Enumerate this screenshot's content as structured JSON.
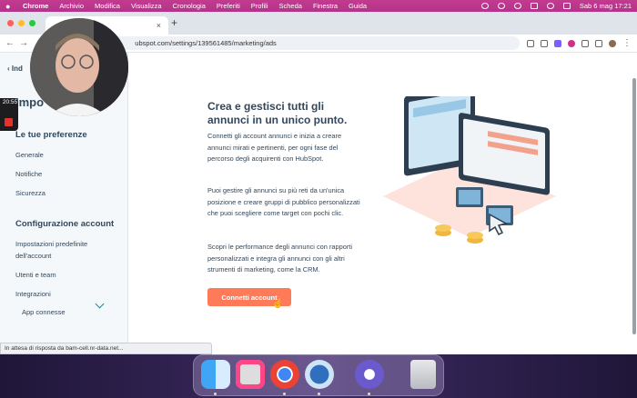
{
  "menubar": {
    "app": "Chrome",
    "items": [
      "Archivio",
      "Modifica",
      "Visualizza",
      "Cronologia",
      "Preferiti",
      "Profili",
      "Scheda",
      "Finestra",
      "Guida"
    ],
    "datetime": "Sab 6 mag  17:21"
  },
  "browser": {
    "tab_close": "×",
    "new_tab": "+",
    "url": "ubspot.com/settings/139561485/marketing/ads",
    "status_text": "In attesa di risposta da bam-cell.nr-data.net..."
  },
  "recorder": {
    "time": "20:55"
  },
  "sidebar": {
    "back_label": "Ind",
    "title": "Impo",
    "sections": [
      {
        "title": "Le tue preferenze",
        "items": [
          "Generale",
          "Notifiche",
          "Sicurezza"
        ]
      },
      {
        "title": "Configurazione account",
        "items": [
          "Impostazioni predefinite dell'account",
          "Utenti e team",
          "Integrazioni",
          "App connesse"
        ]
      }
    ]
  },
  "main": {
    "heading": "Crea e gestisci tutti gli annunci in un unico punto.",
    "paragraphs": [
      "Connetti gli account annunci e inizia a creare annunci mirati e pertinenti, per ogni fase del percorso degli acquirenti con HubSpot.",
      "Puoi gestire gli annunci su più reti da un'unica posizione e creare gruppi di pubblico personalizzati che puoi scegliere come target con pochi clic.",
      "Scopri le performance degli annunci con rapporti personalizzati e integra gli annunci con gli altri strumenti di marketing, come la CRM."
    ],
    "cta": "Connetti account"
  },
  "dock": {
    "apps": [
      "finder-icon",
      "launchpad-icon",
      "chrome-icon",
      "migration-icon",
      "hubspot-app-icon",
      "trash-icon"
    ]
  },
  "colors": {
    "menubar": "#b4338a",
    "cta": "#ff7a59",
    "heading": "#33475b",
    "accent": "#0091ae"
  }
}
